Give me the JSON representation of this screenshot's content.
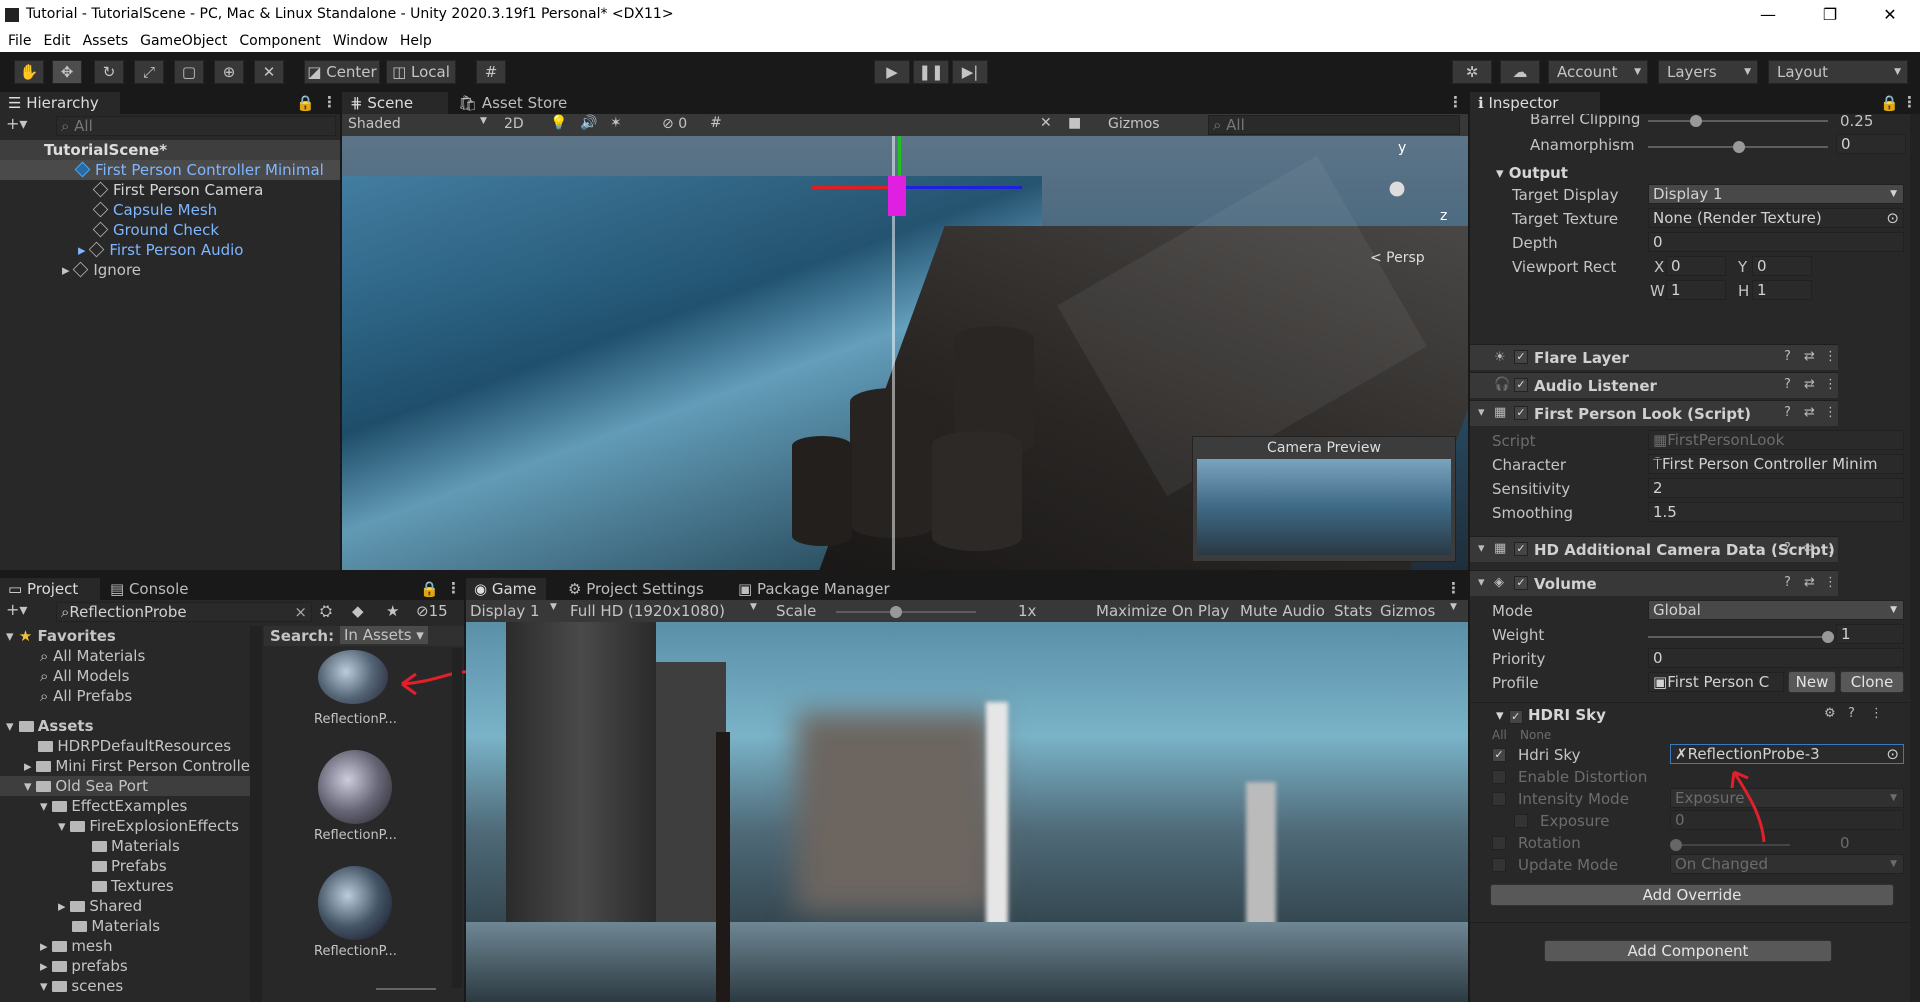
{
  "window": {
    "title": "Tutorial - TutorialScene - PC, Mac & Linux Standalone - Unity 2020.3.19f1 Personal* <DX11>",
    "minimize": "—",
    "maximize": "❐",
    "close": "✕"
  },
  "menu": [
    "File",
    "Edit",
    "Assets",
    "GameObject",
    "Component",
    "Window",
    "Help"
  ],
  "toolbar": {
    "pivot": "Center",
    "space": "Local",
    "account": "Account",
    "layers": "Layers",
    "layout": "Layout"
  },
  "hierarchy": {
    "tab": "Hierarchy",
    "search": "All",
    "scene": "TutorialScene*",
    "items": [
      "First Person Controller Minimal",
      "First Person Camera",
      "Capsule Mesh",
      "Ground Check",
      "First Person Audio",
      "Ignore"
    ]
  },
  "scene": {
    "tabs": [
      "Scene",
      "Asset Store"
    ],
    "shading": "Shaded",
    "mode2d": "2D",
    "hidden_count": "0",
    "gizmos": "Gizmos",
    "search": "All",
    "persp": "< Persp",
    "axis_y": "y",
    "axis_z": "z",
    "preview": "Camera Preview"
  },
  "project": {
    "tabs": [
      "Project",
      "Console"
    ],
    "search": "ReflectionProbe",
    "hidden_count": "15",
    "search_label": "Search:",
    "search_scope": "In Assets",
    "favorites": "Favorites",
    "fav_items": [
      "All Materials",
      "All Models",
      "All Prefabs"
    ],
    "assets": "Assets",
    "tree": [
      "HDRPDefaultResources",
      "Mini First Person Controlle",
      "Old Sea Port",
      "EffectExamples",
      "FireExplosionEffects",
      "Materials",
      "Prefabs",
      "Textures",
      "Shared",
      "Materials",
      "mesh",
      "prefabs",
      "scenes"
    ],
    "results": [
      "ReflectionP...",
      "ReflectionP...",
      "ReflectionP..."
    ]
  },
  "game": {
    "tabs": [
      "Game",
      "Project Settings",
      "Package Manager"
    ],
    "display": "Display 1",
    "resolution": "Full HD (1920x1080)",
    "scale_label": "Scale",
    "scale_value": "1x",
    "maximize": "Maximize On Play",
    "mute": "Mute Audio",
    "stats": "Stats",
    "gizmos": "Gizmos"
  },
  "inspector": {
    "tab": "Inspector",
    "camera": {
      "barrel": "Barrel Clipping",
      "barrel_val": "0.25",
      "anamorphism": "Anamorphism",
      "anamorphism_val": "0",
      "output": "Output",
      "target_display": "Target Display",
      "target_display_val": "Display 1",
      "target_texture": "Target Texture",
      "target_texture_val": "None (Render Texture)",
      "depth": "Depth",
      "depth_val": "0",
      "viewport": "Viewport Rect",
      "x": "X",
      "x_val": "0",
      "y": "Y",
      "y_val": "0",
      "w": "W",
      "w_val": "1",
      "h": "H",
      "h_val": "1"
    },
    "components": [
      "Flare Layer",
      "Audio Listener",
      "First Person Look (Script)",
      "HD Additional Camera Data (Script)",
      "Volume"
    ],
    "look": {
      "script": "Script",
      "script_val": "FirstPersonLook",
      "character": "Character",
      "character_val": "First Person Controller Minim",
      "sensitivity": "Sensitivity",
      "sensitivity_val": "2",
      "smoothing": "Smoothing",
      "smoothing_val": "1.5"
    },
    "volume": {
      "mode": "Mode",
      "mode_val": "Global",
      "weight": "Weight",
      "weight_val": "1",
      "priority": "Priority",
      "priority_val": "0",
      "profile": "Profile",
      "profile_val": "First Person C",
      "new": "New",
      "clone": "Clone"
    },
    "hdri": {
      "title": "HDRI Sky",
      "all": "All",
      "none": "None",
      "sky": "Hdri Sky",
      "sky_val": "ReflectionProbe-3",
      "distortion": "Enable Distortion",
      "intensity_mode": "Intensity Mode",
      "intensity_mode_val": "Exposure",
      "exposure": "Exposure",
      "exposure_val": "0",
      "rotation": "Rotation",
      "rotation_val": "0",
      "update": "Update Mode",
      "update_val": "On Changed"
    },
    "add_override": "Add Override",
    "add_component": "Add Component"
  },
  "colors": {
    "accent": "#3a79bb",
    "annotation": "#e0202a"
  }
}
